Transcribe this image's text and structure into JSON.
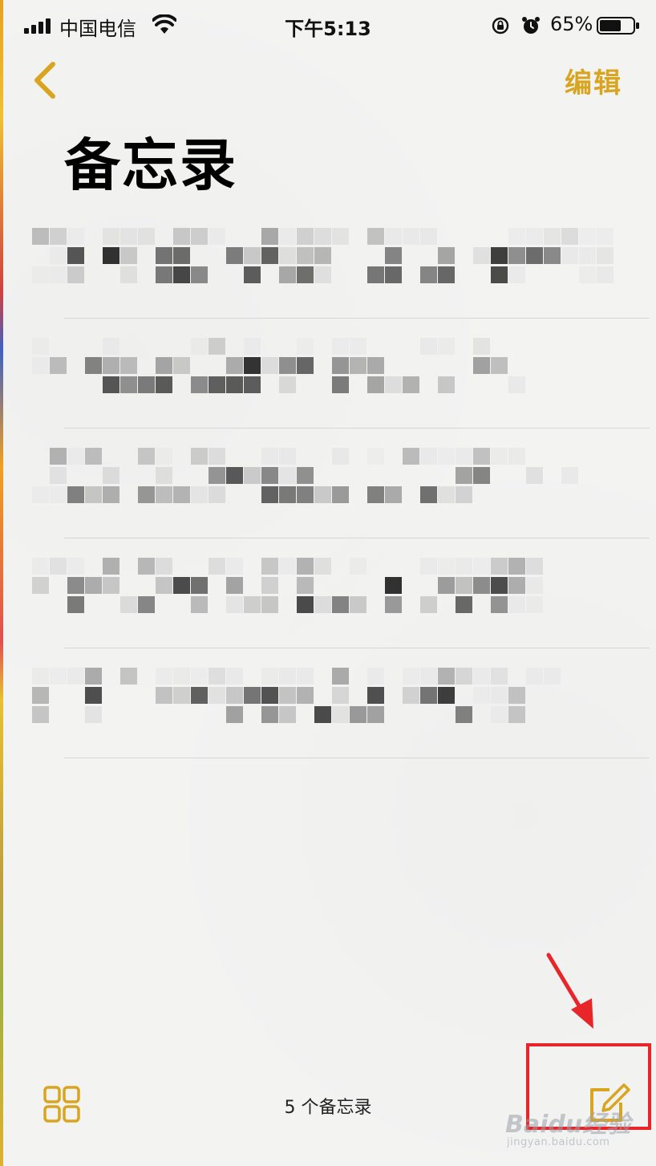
{
  "status_bar": {
    "carrier": "中国电信",
    "time": "下午5:13",
    "battery_percent": "65%",
    "battery_level": 0.65,
    "icons": [
      "signal-icon",
      "wifi-icon",
      "rotation-lock-icon",
      "alarm-icon",
      "battery-icon"
    ]
  },
  "nav": {
    "back_icon": "chevron-left-icon",
    "edit_label": "编辑"
  },
  "page_title": "备忘录",
  "notes": {
    "count_visible": 5,
    "items": [
      "",
      "",
      "",
      "",
      ""
    ],
    "content_note": "note titles and previews are pixelated / obscured"
  },
  "toolbar": {
    "gallery_icon": "gallery-view-icon",
    "note_count_label": "5 个备忘录",
    "compose_icon": "compose-note-icon"
  },
  "annotation": {
    "arrow_color": "#e8262a",
    "highlight_box_color": "#e8262a"
  },
  "watermark": {
    "text": "Baidu经验",
    "subtext": "jingyan.baidu.com"
  },
  "colors": {
    "accent": "#d9a520",
    "background": "#f3f3f2",
    "separator": "#d6d6d4"
  }
}
